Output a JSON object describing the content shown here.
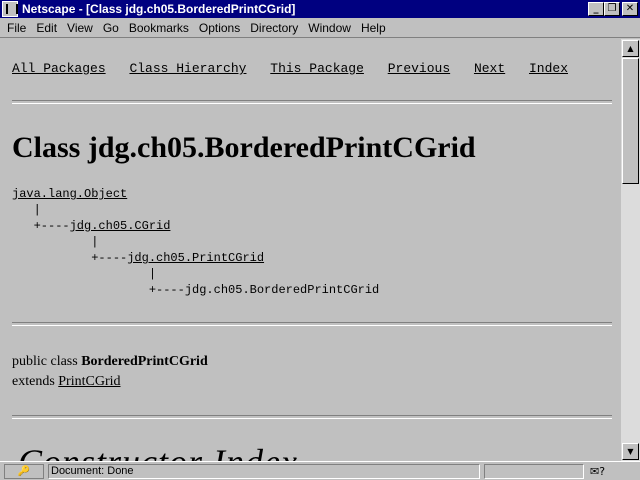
{
  "window": {
    "title": "Netscape - [Class jdg.ch05.BorderedPrintCGrid]",
    "minimize": "_",
    "restore": "❐",
    "close": "✕"
  },
  "menu": [
    "File",
    "Edit",
    "View",
    "Go",
    "Bookmarks",
    "Options",
    "Directory",
    "Window",
    "Help"
  ],
  "nav": {
    "all_packages": "All Packages",
    "class_hierarchy": "Class Hierarchy",
    "this_package": "This Package",
    "previous": "Previous",
    "next": "Next",
    "index": "Index"
  },
  "page": {
    "title": "Class jdg.ch05.BorderedPrintCGrid",
    "tree": {
      "root": "java.lang.Object",
      "level1": "jdg.ch05.CGrid",
      "level2": "jdg.ch05.PrintCGrid",
      "level3": "jdg.ch05.BorderedPrintCGrid"
    },
    "decl": {
      "prefix": "public class ",
      "class_name": "BorderedPrintCGrid",
      "extends_label": "extends ",
      "extends_link": "PrintCGrid"
    },
    "section_heading": "Constructor Index"
  },
  "status": {
    "text": "Document: Done",
    "security_icon": "🔑",
    "mail_icon": "✉?"
  },
  "scrollbar": {
    "up": "▲",
    "down": "▼"
  }
}
